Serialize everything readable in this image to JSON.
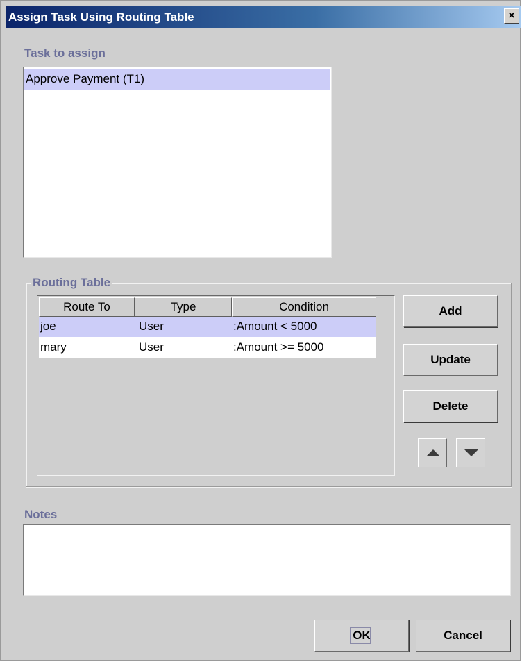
{
  "window": {
    "title": "Assign Task Using Routing Table",
    "close_glyph": "×"
  },
  "task_section": {
    "label": "Task to assign",
    "items": [
      {
        "label": "Approve Payment (T1)",
        "selected": true
      }
    ]
  },
  "routing_table": {
    "label": "Routing Table",
    "columns": [
      "Route To",
      "Type",
      "Condition"
    ],
    "rows": [
      {
        "route_to": "joe",
        "type": "User",
        "condition": ":Amount < 5000",
        "selected": true
      },
      {
        "route_to": "mary",
        "type": "User",
        "condition": ":Amount >= 5000",
        "selected": false
      }
    ],
    "buttons": {
      "add": "Add",
      "update": "Update",
      "delete": "Delete"
    }
  },
  "notes": {
    "label": "Notes",
    "value": ""
  },
  "footer": {
    "ok_label": "OK",
    "cancel_label": "Cancel"
  },
  "colors": {
    "selection": "#cccdf8",
    "section_label": "#6b6f9a",
    "dialog_bg": "#cfcfcf"
  }
}
